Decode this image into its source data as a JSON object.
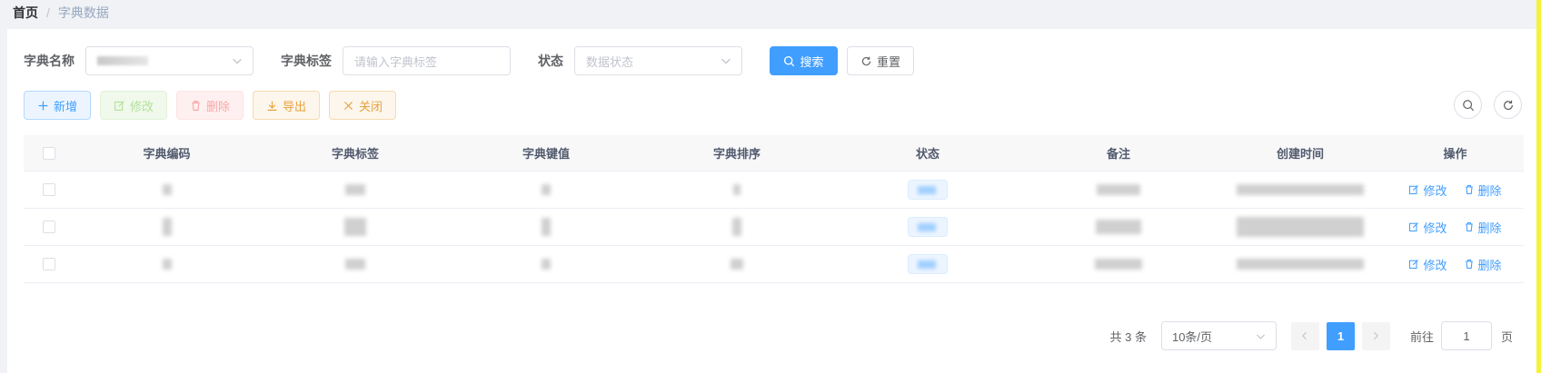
{
  "breadcrumb": {
    "home": "首页",
    "separator": "/",
    "current": "字典数据"
  },
  "search_form": {
    "dict_name_label": "字典名称",
    "dict_label_label": "字典标签",
    "dict_label_placeholder": "请输入字典标签",
    "status_label": "状态",
    "status_placeholder": "数据状态",
    "search_button": "搜索",
    "reset_button": "重置"
  },
  "toolbar": {
    "add": "新增",
    "edit": "修改",
    "delete": "删除",
    "export": "导出",
    "close": "关闭"
  },
  "table": {
    "columns": [
      "字典编码",
      "字典标签",
      "字典键值",
      "字典排序",
      "状态",
      "备注",
      "创建时间",
      "操作"
    ],
    "row_actions": {
      "edit": "修改",
      "delete": "删除"
    }
  },
  "pagination": {
    "total_text": "共 3 条",
    "page_size": "10条/页",
    "current_page": "1",
    "goto_label": "前往",
    "goto_value": "1",
    "page_suffix": "页"
  },
  "colors": {
    "primary": "#409eff",
    "warning": "#e6a23c",
    "danger": "#f56c6c",
    "success": "#67c23a"
  }
}
